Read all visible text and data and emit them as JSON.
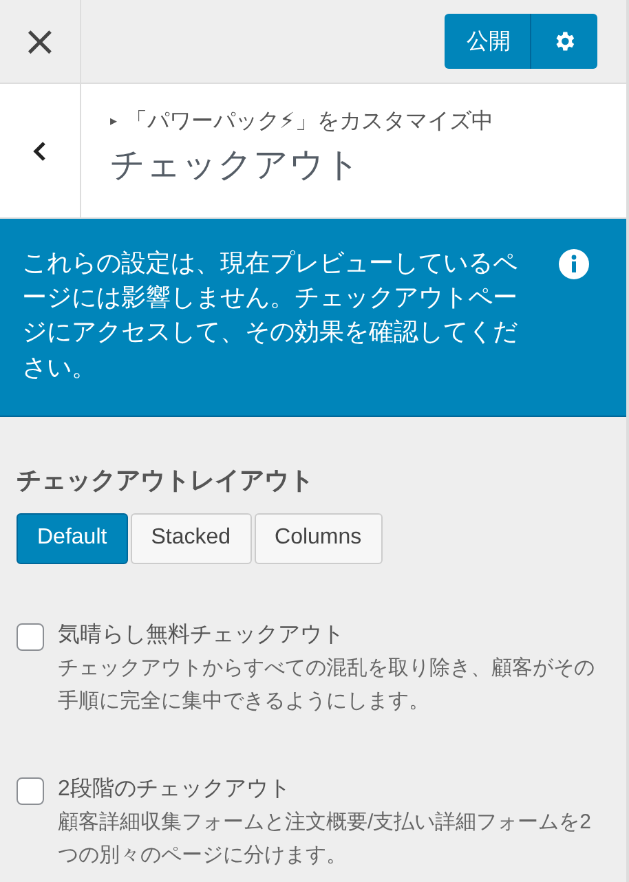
{
  "top_bar": {
    "close": "×",
    "publish_button": "公開"
  },
  "header": {
    "breadcrumb_marker": "▸",
    "breadcrumb": "「パワーパック⚡」をカスタマイズ中",
    "title": "チェックアウト"
  },
  "notice": {
    "text": "これらの設定は、現在プレビューしているページには影響しません。チェックアウトページにアクセスして、その効果を確認してください。"
  },
  "layout_section": {
    "title": "チェックアウトレイアウト",
    "options": [
      {
        "label": "Default",
        "selected": true
      },
      {
        "label": "Stacked",
        "selected": false
      },
      {
        "label": "Columns",
        "selected": false
      }
    ]
  },
  "options": [
    {
      "label": "気晴らし無料チェックアウト",
      "description": "チェックアウトからすべての混乱を取り除き、顧客がその手順に完全に集中できるようにします。",
      "checked": false
    },
    {
      "label": "2段階のチェックアウト",
      "description": "顧客詳細収集フォームと注文概要/支払い詳細フォームを2つの別々のページに分けます。",
      "checked": false
    }
  ]
}
